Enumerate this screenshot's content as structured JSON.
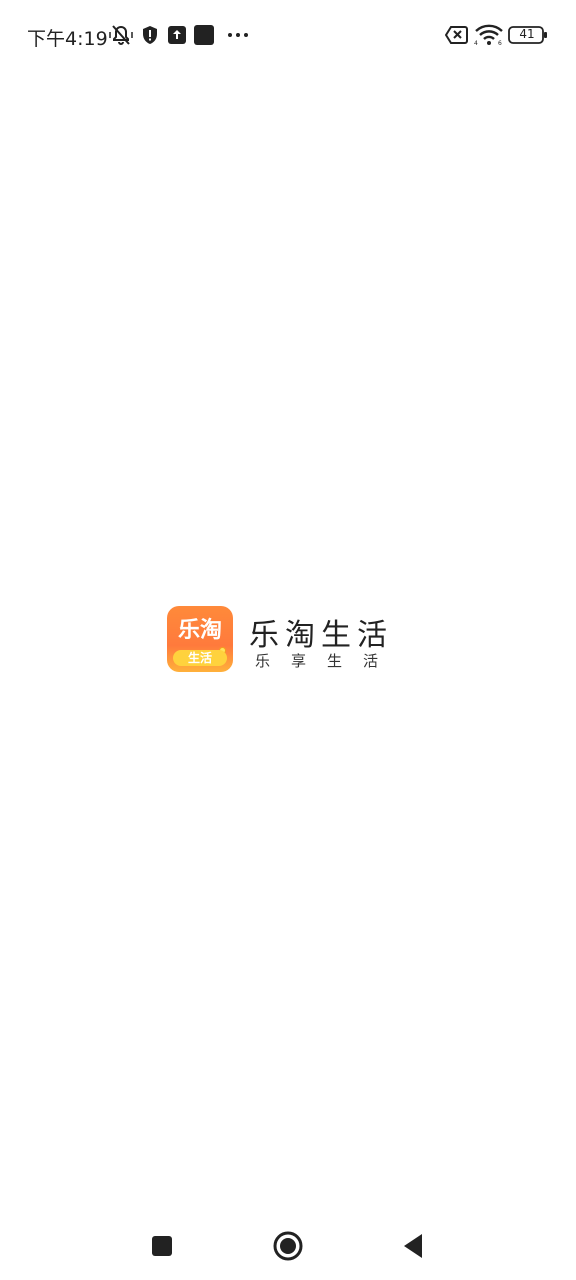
{
  "status_bar": {
    "time": "下午4:19",
    "battery_level": "41",
    "icons": [
      "silent-bell-icon",
      "shield-alert-icon",
      "upload-icon",
      "stop-square-icon",
      "more-dots-icon",
      "sim-error-icon",
      "wifi-icon",
      "battery-icon"
    ]
  },
  "splash": {
    "logo_text_top": "乐淘",
    "logo_text_bottom": "生活",
    "app_name": "乐淘生活",
    "slogan": "乐享生活"
  },
  "nav_bar": {
    "buttons": [
      "recents-button",
      "home-button",
      "back-button"
    ]
  },
  "colors": {
    "background": "#ffffff",
    "logo_orange": "#ff7a3c",
    "logo_yellow": "#ffd23d",
    "text_dark": "#222222"
  }
}
